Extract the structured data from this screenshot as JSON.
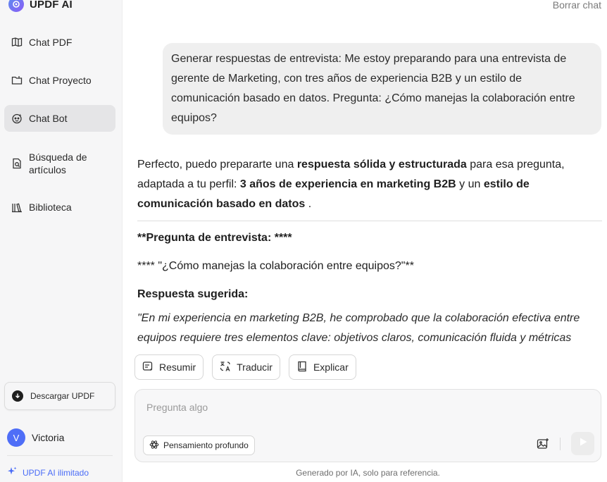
{
  "app": {
    "name": "UPDF AI"
  },
  "sidebar": {
    "items": [
      {
        "label": "Chat PDF",
        "icon": "book-open-icon"
      },
      {
        "label": "Chat Proyecto",
        "icon": "folder-icon"
      },
      {
        "label": "Chat Bot",
        "icon": "bot-icon",
        "active": true
      },
      {
        "label_line1": "Búsqueda de",
        "label_line2": "artículos",
        "icon": "doc-search-icon"
      },
      {
        "label": "Biblioteca",
        "icon": "library-icon"
      }
    ],
    "download_label": "Descargar UPDF",
    "user": {
      "initial": "V",
      "name": "Victoria"
    },
    "unlimited_label": "UPDF AI ilimitado"
  },
  "header": {
    "clear_chat": "Borrar chat"
  },
  "conversation": {
    "user_message": "Generar respuestas de entrevista: Me estoy preparando para una entrevista de gerente de Marketing, con tres años de experiencia B2B y un estilo de comunicación basado en datos. Pregunta: ¿Cómo manejas la colaboración entre equipos?",
    "answer": {
      "intro_1": "Perfecto, puedo prepararte una ",
      "intro_b1": "respuesta sólida y estructurada",
      "intro_2": " para esa pregunta, adaptada a tu perfil: ",
      "intro_b2": "3 años de experiencia en marketing B2B",
      "intro_3": " y un ",
      "intro_b3": "estilo de comunicación basado en datos",
      "intro_4": " .",
      "question_heading": "**Pregunta de entrevista: ****",
      "question_line": "**** \"¿Cómo manejas la colaboración entre equipos?\"**",
      "response_heading": "Respuesta sugerida:",
      "response_text": "\"En mi experiencia en marketing B2B, he comprobado que la colaboración efectiva entre equipos requiere tres elementos clave: objetivos claros, comunicación fluida y métricas"
    }
  },
  "actions": {
    "summarize": "Resumir",
    "translate": "Traducir",
    "explain": "Explicar"
  },
  "composer": {
    "placeholder": "Pregunta algo",
    "deep_thinking": "Pensamiento profundo"
  },
  "footer": {
    "disclaimer": "Generado por IA, solo para referencia."
  },
  "colors": {
    "accent": "#4a6cf7",
    "avatar": "#4f6ef7",
    "active_nav": "#e5e5e7"
  }
}
